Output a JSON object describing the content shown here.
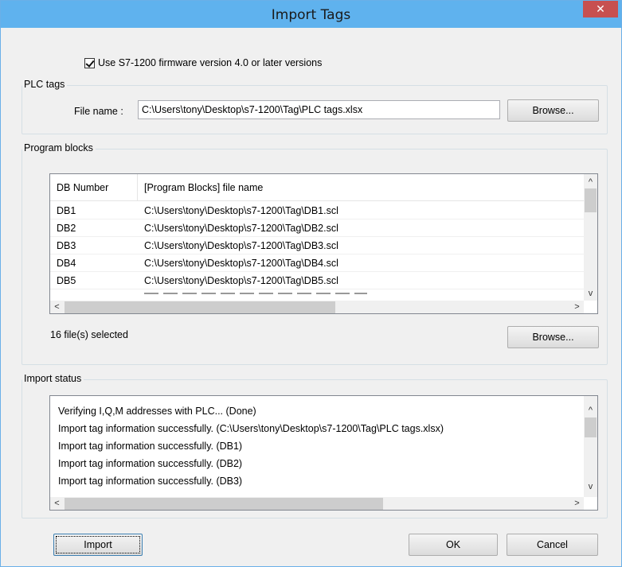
{
  "window": {
    "title": "Import Tags",
    "close_glyph": "✕"
  },
  "firmware": {
    "checked": true,
    "label": "Use S7-1200 firmware version 4.0 or later versions"
  },
  "plc_tags": {
    "legend": "PLC tags",
    "file_label": "File name :",
    "file_value": "C:\\Users\\tony\\Desktop\\s7-1200\\Tag\\PLC tags.xlsx",
    "browse_label": "Browse..."
  },
  "program_blocks": {
    "legend": "Program blocks",
    "columns": [
      "DB Number",
      "[Program Blocks] file name"
    ],
    "rows": [
      {
        "db": "DB1",
        "file": "C:\\Users\\tony\\Desktop\\s7-1200\\Tag\\DB1.scl"
      },
      {
        "db": "DB2",
        "file": "C:\\Users\\tony\\Desktop\\s7-1200\\Tag\\DB2.scl"
      },
      {
        "db": "DB3",
        "file": "C:\\Users\\tony\\Desktop\\s7-1200\\Tag\\DB3.scl"
      },
      {
        "db": "DB4",
        "file": "C:\\Users\\tony\\Desktop\\s7-1200\\Tag\\DB4.scl"
      },
      {
        "db": "DB5",
        "file": "C:\\Users\\tony\\Desktop\\s7-1200\\Tag\\DB5.scl"
      }
    ],
    "selected_text": "16 file(s) selected",
    "browse_label": "Browse..."
  },
  "import_status": {
    "legend": "Import status",
    "lines": [
      "Verifying I,Q,M addresses with PLC... (Done)",
      "Import tag information successfully. (C:\\Users\\tony\\Desktop\\s7-1200\\Tag\\PLC tags.xlsx)",
      "Import tag information successfully. (DB1)",
      "Import tag information successfully. (DB2)",
      "Import tag information successfully. (DB3)"
    ]
  },
  "footer": {
    "import_label": "Import",
    "ok_label": "OK",
    "cancel_label": "Cancel"
  },
  "scroll_glyphs": {
    "up": "^",
    "down": "v",
    "left": "<",
    "right": ">"
  },
  "colors": {
    "titlebar": "#5fb2ee",
    "close": "#c75050",
    "dialog_bg": "#f0f0f0"
  }
}
